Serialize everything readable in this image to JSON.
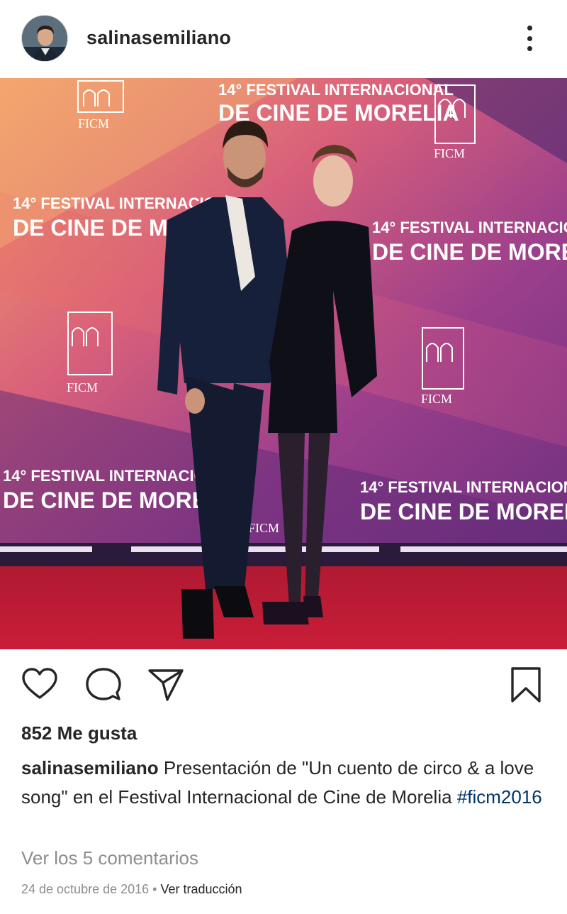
{
  "post": {
    "username": "salinasemiliano",
    "likes_text": "852 Me gusta",
    "caption_user": "salinasemiliano",
    "caption_text": "Presentación de \"Un cuento de circo & a love song\" en el Festival Internacional de Cine de Morelia",
    "hashtag": "#ficm2016",
    "view_comments": "Ver los 5 comentarios",
    "date": "24 de octubre de 2016",
    "separator": "•",
    "translate_label": "Ver traducción"
  },
  "photo": {
    "backdrop_line1": "14° FESTIVAL INTERNACIONAL",
    "backdrop_line2": "DE CINE DE MORELIA",
    "logo_text": "FICM"
  },
  "icons": {
    "more": "more-options-icon",
    "like": "heart-icon",
    "comment": "comment-icon",
    "share": "paper-plane-icon",
    "save": "bookmark-icon"
  },
  "colors": {
    "text": "#262626",
    "muted": "#8e8e8e",
    "hashtag": "#003569",
    "carpet": "#b3142d"
  }
}
